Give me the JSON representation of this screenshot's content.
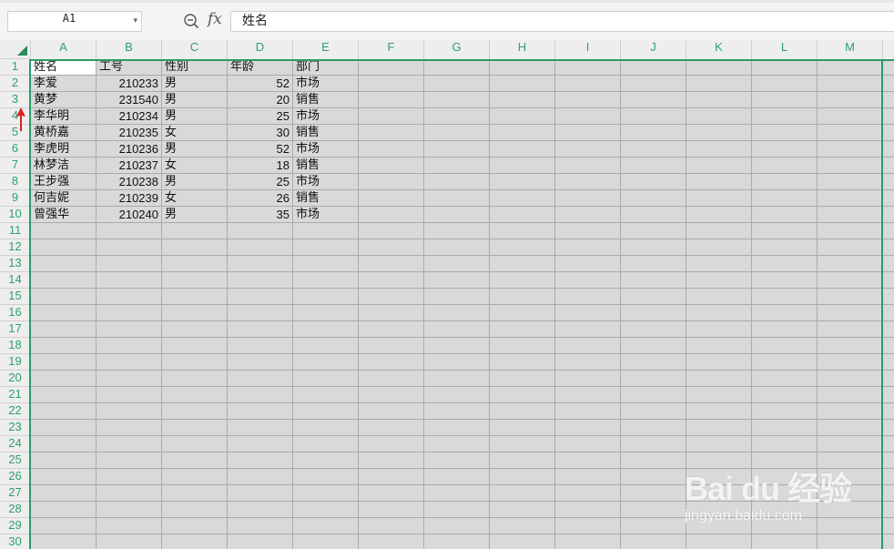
{
  "formula_bar": {
    "name_box": "A1",
    "fx": "fx",
    "formula": "姓名"
  },
  "columns": [
    "A",
    "B",
    "C",
    "D",
    "E",
    "F",
    "G",
    "H",
    "I",
    "J",
    "K",
    "L",
    "M"
  ],
  "rows": [
    "1",
    "2",
    "3",
    "4",
    "5",
    "6",
    "7",
    "8",
    "9",
    "10",
    "11",
    "12",
    "13",
    "14",
    "15",
    "16",
    "17",
    "18",
    "19",
    "20",
    "21",
    "22",
    "23",
    "24",
    "25",
    "26",
    "27",
    "28",
    "29",
    "30"
  ],
  "table": {
    "headers": [
      "姓名",
      "工号",
      "性别",
      "年龄",
      "部门"
    ],
    "rows": [
      [
        "李爱",
        "210233",
        "男",
        "52",
        "市场"
      ],
      [
        "黄梦",
        "231540",
        "男",
        "20",
        "销售"
      ],
      [
        "李华明",
        "210234",
        "男",
        "25",
        "市场"
      ],
      [
        "黄桥嘉",
        "210235",
        "女",
        "30",
        "销售"
      ],
      [
        "李虎明",
        "210236",
        "男",
        "52",
        "市场"
      ],
      [
        "林梦洁",
        "210237",
        "女",
        "18",
        "销售"
      ],
      [
        "王步强",
        "210238",
        "男",
        "25",
        "市场"
      ],
      [
        "何吉妮",
        "210239",
        "女",
        "26",
        "销售"
      ],
      [
        "曾强华",
        "210240",
        "男",
        "35",
        "市场"
      ]
    ]
  },
  "colors": {
    "accent_green": "#2b9b67",
    "annotation_red": "#e02020"
  },
  "icons": {
    "zoom": "zoom-out-icon",
    "dropdown": "chevron-down-icon",
    "annotation": "red-arrow-icon"
  },
  "watermark": {
    "logo": "Bai du 经验",
    "url": "jingyan.baidu.com"
  }
}
